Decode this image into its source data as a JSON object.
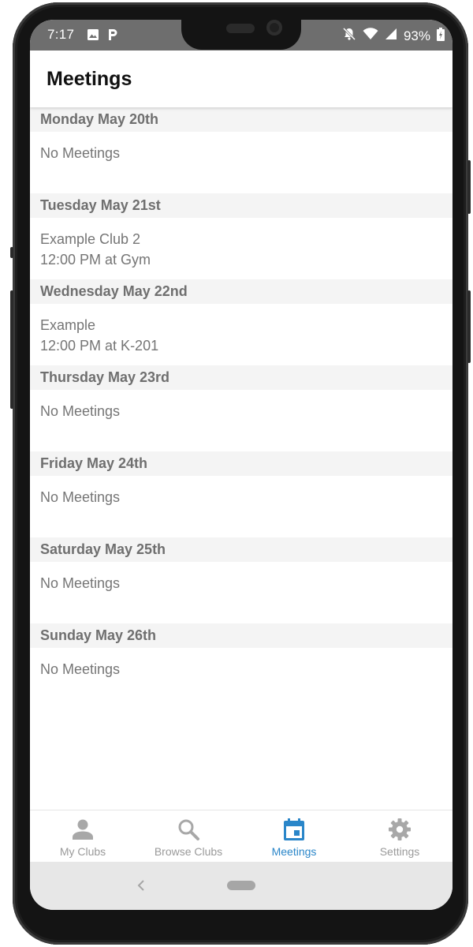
{
  "status_bar": {
    "time": "7:17",
    "battery": "93%",
    "left_icons": [
      "image-icon",
      "p-app-icon"
    ],
    "right_icons": [
      "notifications-off-icon",
      "wifi-icon",
      "signal-icon",
      "battery-icon"
    ]
  },
  "header": {
    "title": "Meetings"
  },
  "days": [
    {
      "date": "Monday May 20th",
      "lines": [
        "No Meetings"
      ]
    },
    {
      "date": "Tuesday May 21st",
      "lines": [
        "Example Club 2",
        "12:00 PM at Gym"
      ]
    },
    {
      "date": "Wednesday May 22nd",
      "lines": [
        "Example",
        "12:00 PM at K-201"
      ]
    },
    {
      "date": "Thursday May 23rd",
      "lines": [
        "No Meetings"
      ]
    },
    {
      "date": "Friday May 24th",
      "lines": [
        "No Meetings"
      ]
    },
    {
      "date": "Saturday May 25th",
      "lines": [
        "No Meetings"
      ]
    },
    {
      "date": "Sunday May 26th",
      "lines": [
        "No Meetings"
      ]
    }
  ],
  "bottom_nav": {
    "items": [
      {
        "label": "My Clubs",
        "icon": "person-icon",
        "active": false
      },
      {
        "label": "Browse Clubs",
        "icon": "search-icon",
        "active": false
      },
      {
        "label": "Meetings",
        "icon": "calendar-icon",
        "active": true
      },
      {
        "label": "Settings",
        "icon": "gear-icon",
        "active": false
      }
    ]
  },
  "colors": {
    "accent": "#2a86c9",
    "inactive": "#9a9a9a",
    "section_header_bg": "#f4f4f4",
    "status_bar_bg": "#6e6e6e"
  }
}
